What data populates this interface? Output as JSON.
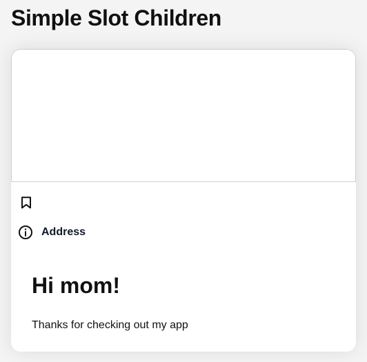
{
  "page": {
    "title": "Simple Slot Children"
  },
  "card": {
    "icons": {
      "bookmark": "bookmark-icon",
      "info": "info-icon"
    },
    "address_label": "Address",
    "heading": "Hi mom!",
    "body_text": "Thanks for checking out my app"
  },
  "colors": {
    "background": "#f4f4f4",
    "card": "#ffffff",
    "text": "#111111",
    "border": "#cfcfcf"
  }
}
